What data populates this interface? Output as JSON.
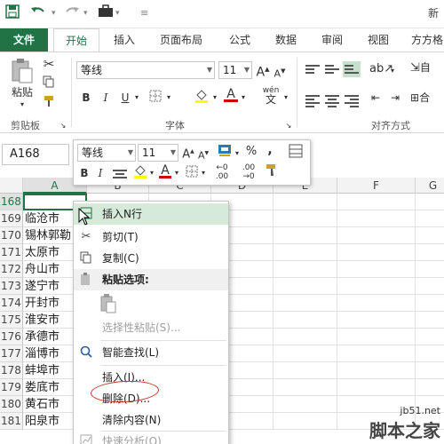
{
  "title_fragment": "新",
  "tabs": [
    "文件",
    "开始",
    "插入",
    "页面布局",
    "公式",
    "数据",
    "审阅",
    "视图",
    "方方格"
  ],
  "ribbon": {
    "clipboard_label": "剪贴板",
    "paste_label": "粘贴",
    "font_group_label": "字体",
    "align_group_label": "对齐方式",
    "font_name": "等线",
    "font_size": "11",
    "grow_font": "A",
    "shrink_font": "A",
    "bold": "B",
    "italic": "I",
    "underline": "U",
    "font_color": "A",
    "phonetic": "wén",
    "wrap_partial": "自",
    "merge_partial": "合"
  },
  "name_box": "A168",
  "mini_toolbar": {
    "font_name": "等线",
    "font_size": "11",
    "percent": "%",
    "comma": ",",
    "bold": "B",
    "italic": "I",
    "font_color": "A",
    "inc_decimal": ".00",
    "dec_decimal": ".00"
  },
  "columns": [
    "A",
    "B",
    "C",
    "D",
    "E",
    "F",
    "G"
  ],
  "rows": [
    {
      "num": "168",
      "a": ""
    },
    {
      "num": "169",
      "a": "临沧市"
    },
    {
      "num": "170",
      "a": "锡林郭勒"
    },
    {
      "num": "171",
      "a": "太原市"
    },
    {
      "num": "172",
      "a": "舟山市"
    },
    {
      "num": "173",
      "a": "遂宁市"
    },
    {
      "num": "174",
      "a": "开封市"
    },
    {
      "num": "175",
      "a": "淮安市"
    },
    {
      "num": "176",
      "a": "承德市"
    },
    {
      "num": "177",
      "a": "淄博市"
    },
    {
      "num": "178",
      "a": "蚌埠市"
    },
    {
      "num": "179",
      "a": "娄底市"
    },
    {
      "num": "180",
      "a": "黄石市"
    },
    {
      "num": "181",
      "a": "阳泉市"
    }
  ],
  "context_menu": {
    "insert_n_rows": "插入N行",
    "cut": "剪切(T)",
    "copy": "复制(C)",
    "paste_options": "粘贴选项:",
    "paste_special": "选择性粘贴(S)...",
    "smart_lookup": "智能查找(L)",
    "insert": "插入(I)...",
    "delete": "删除(D)...",
    "clear_contents": "清除内容(N)",
    "quick_analysis": "快速分析(Q)"
  },
  "watermark": {
    "domain": "jb51.net",
    "name": "脚本之家"
  },
  "colors": {
    "excel_green": "#217346",
    "highlight": "#d5ead9",
    "annotation_red": "#c0392b"
  }
}
